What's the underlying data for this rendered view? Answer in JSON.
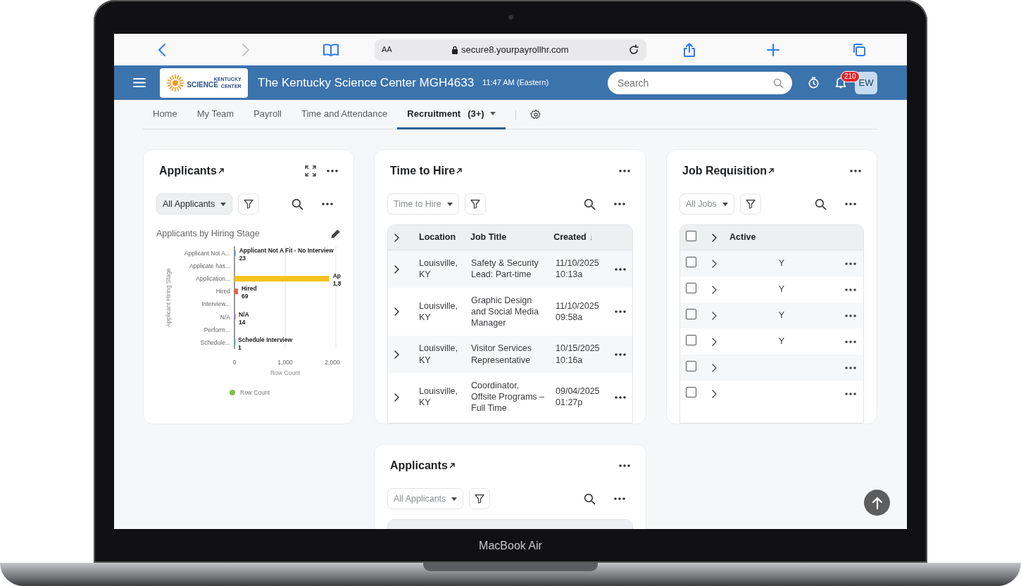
{
  "device": {
    "label": "MacBook Air"
  },
  "browser": {
    "back_enabled": true,
    "forward_enabled": false,
    "text_size": "AA",
    "url": "secure8.yourpayrollhr.com"
  },
  "header": {
    "logo": {
      "top": "KENTUCKY",
      "main": "SCIENCE",
      "side": "CENTER"
    },
    "title": "The Kentucky Science Center MGH4633",
    "time": "11:47 AM (Eastern)",
    "search": {
      "placeholder": "Search"
    },
    "notifications": "210",
    "avatar": "EW"
  },
  "tabs": [
    {
      "label": "Home",
      "selected": false,
      "menu": false
    },
    {
      "label": "My Team",
      "selected": false,
      "menu": false
    },
    {
      "label": "Payroll",
      "selected": false,
      "menu": false
    },
    {
      "label": "Time and Attendance",
      "selected": false,
      "menu": false
    },
    {
      "label": "Recruitment",
      "count": "(3+)",
      "selected": true,
      "menu": true
    }
  ],
  "widgets": [
    {
      "kind": "chart",
      "title": "Applicants",
      "expandable": true,
      "filter": {
        "label": "All Applicants"
      },
      "subtitle": "Applicants by Hiring Stage",
      "chart_data": {
        "type": "bar",
        "orientation": "horizontal",
        "xlabel": "Row Count",
        "ylabel": "Applicant Hiring Stage",
        "categories": [
          "Applicant Not A...",
          "Applicate has...",
          "Application...",
          "Hired",
          "Interview...",
          "N/A",
          "Perform...",
          "Schedule..."
        ],
        "series": [
          {
            "name": "Row Count",
            "color": "#7cc242",
            "values": [
              23,
              null,
              1870,
              69,
              null,
              14,
              null,
              1
            ],
            "colors": [
              "#5b8fd6",
              null,
              "#f7c21a",
              "#ec5b45",
              null,
              "#9b6fd1",
              null,
              "#4fb0c6"
            ]
          }
        ],
        "xlim": [
          0,
          2000
        ],
        "xticks": [
          {
            "value": 0,
            "label": "0"
          },
          {
            "value": 1000,
            "label": "1,000"
          },
          {
            "value": 2000,
            "label": "2,000"
          }
        ],
        "annotations": [
          {
            "text": "Applicant Not A Fit - No Interview",
            "x": 23
          },
          {
            "text": "23",
            "x": 23
          },
          {
            "text": "Ap",
            "x": 1870
          },
          {
            "text": "1,8",
            "x": 1870
          },
          {
            "text": "Hired",
            "x": 69
          },
          {
            "text": "69",
            "x": 69
          },
          {
            "text": "N/A",
            "x": 14
          },
          {
            "text": "14",
            "x": 14
          },
          {
            "text": "Schedule Interview",
            "x": 1
          },
          {
            "text": "1",
            "x": 1
          }
        ]
      }
    },
    {
      "kind": "jobs_table",
      "title": "Time to Hire",
      "filter": {
        "label": "Time to Hire"
      },
      "columns": [
        {
          "label": "Location"
        },
        {
          "label": "Job Title"
        },
        {
          "label": "Created",
          "sort": "↓"
        }
      ],
      "rows": [
        {
          "cells": [
            "Louisville, KY",
            "Safety & Security Lead: Part-time",
            "11/10/2025 10:13a"
          ]
        },
        {
          "cells": [
            "Louisville, KY",
            "Graphic Design and Social Media Manager",
            "11/10/2025 09:58a"
          ]
        },
        {
          "cells": [
            "Louisville, KY",
            "Visitor Services Representative",
            "10/15/2025 10:16a"
          ]
        },
        {
          "cells": [
            "Louisville, KY",
            "Coordinator, Offsite Programs – Full Time",
            "09/04/2025 01:27p"
          ]
        }
      ]
    },
    {
      "kind": "requisition_table",
      "title": "Job Requisition",
      "filter": {
        "label": "All Jobs"
      },
      "all_checked": false,
      "columns": [
        {
          "label": "Active"
        }
      ],
      "rows": [
        {
          "checked": false,
          "active": "Y"
        },
        {
          "checked": false,
          "active": "Y"
        },
        {
          "checked": false,
          "active": "Y"
        },
        {
          "checked": false,
          "active": "Y"
        },
        {
          "checked": false
        },
        {
          "checked": false
        }
      ]
    },
    {
      "kind": "people_table",
      "title": "Applicants",
      "filter": {
        "label": "All Applicants"
      }
    }
  ]
}
